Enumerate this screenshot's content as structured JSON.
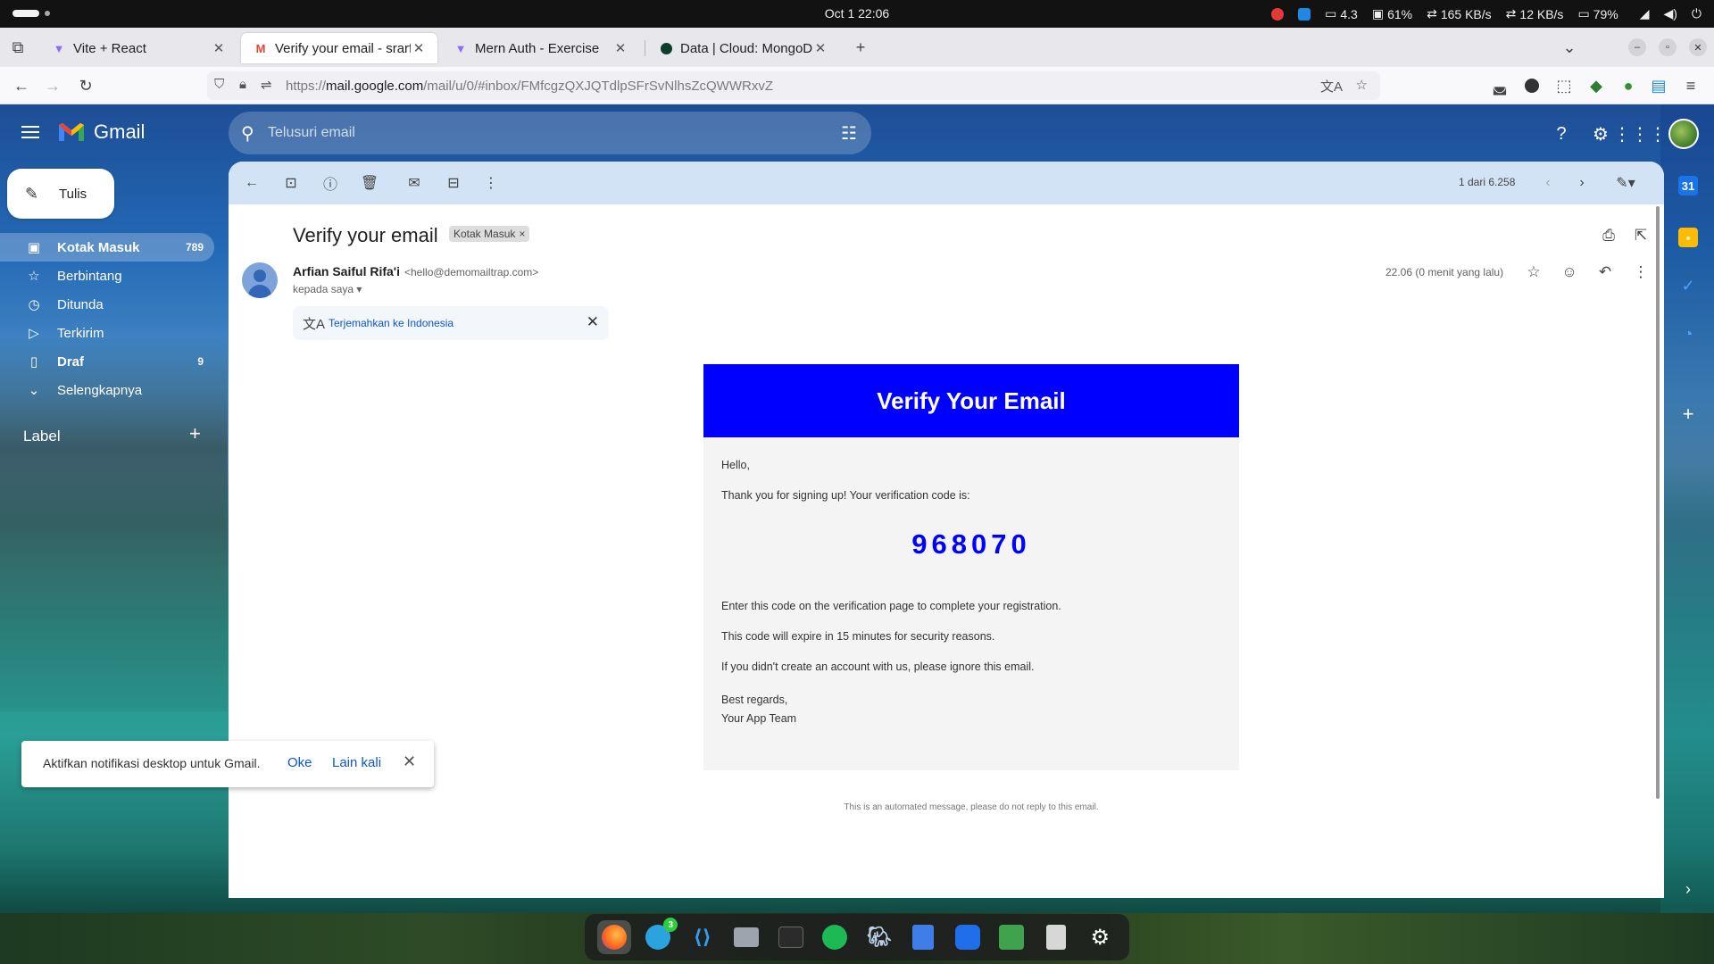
{
  "os": {
    "clock": "Oct 1  22:06",
    "cpu_temp": "4.3",
    "cpu": "61%",
    "net_down": "165 KB/s",
    "net_up": "12 KB/s",
    "battery": "79%"
  },
  "tabs": [
    {
      "title": "Vite + React",
      "icon": "vite-icon"
    },
    {
      "title": "Verify your email - srarfian",
      "icon": "gmail-icon"
    },
    {
      "title": "Mern Auth - Exercise",
      "icon": "vite-icon"
    },
    {
      "title": "Data | Cloud: MongoDB C",
      "icon": "mongodb-icon"
    }
  ],
  "url": {
    "prefix": "https://",
    "host": "mail.google.com",
    "path": "/mail/u/0/#inbox/FMfcgzQXJQTdlpSFrSvNlhsZcQWWRxvZ"
  },
  "gmail": {
    "brand": "Gmail",
    "search_placeholder": "Telusuri email",
    "compose_label": "Tulis",
    "nav": [
      {
        "label": "Kotak Masuk",
        "count": "789",
        "icon": "inbox-icon"
      },
      {
        "label": "Berbintang",
        "count": "",
        "icon": "star-icon"
      },
      {
        "label": "Ditunda",
        "count": "",
        "icon": "clock-icon"
      },
      {
        "label": "Terkirim",
        "count": "",
        "icon": "send-icon"
      },
      {
        "label": "Draf",
        "count": "9",
        "icon": "draft-icon"
      },
      {
        "label": "Selengkapnya",
        "count": "",
        "icon": "chevron-down-icon"
      }
    ],
    "label_header": "Label",
    "toolbar_count": "1 dari 6.258"
  },
  "message": {
    "subject": "Verify your email",
    "chip": "Kotak Masuk",
    "sender_name": "Arfian Saiful Rifa'i",
    "sender_email": "<hello@demomailtrap.com>",
    "to": "kepada saya",
    "time": "22.06 (0 menit yang lalu)",
    "translate_label": "Terjemahkan ke Indonesia"
  },
  "email": {
    "header": "Verify Your Email",
    "greeting": "Hello,",
    "intro": "Thank you for signing up! Your verification code is:",
    "code": "968070",
    "instruction": "Enter this code on the verification page to complete your registration.",
    "expiry": "This code will expire in 15 minutes for security reasons.",
    "ignore": "If you didn't create an account with us, please ignore this email.",
    "regards": "Best regards,",
    "team": "Your App Team",
    "footer": "This is an automated message, please do not reply to this email.",
    "header_color": "#0000ff"
  },
  "notification": {
    "text": "Aktifkan notifikasi desktop untuk Gmail.",
    "ok": "Oke",
    "later": "Lain kali"
  },
  "side_panel": {
    "calendar_day": "31"
  },
  "dock": {
    "telegram_badge": "3"
  }
}
